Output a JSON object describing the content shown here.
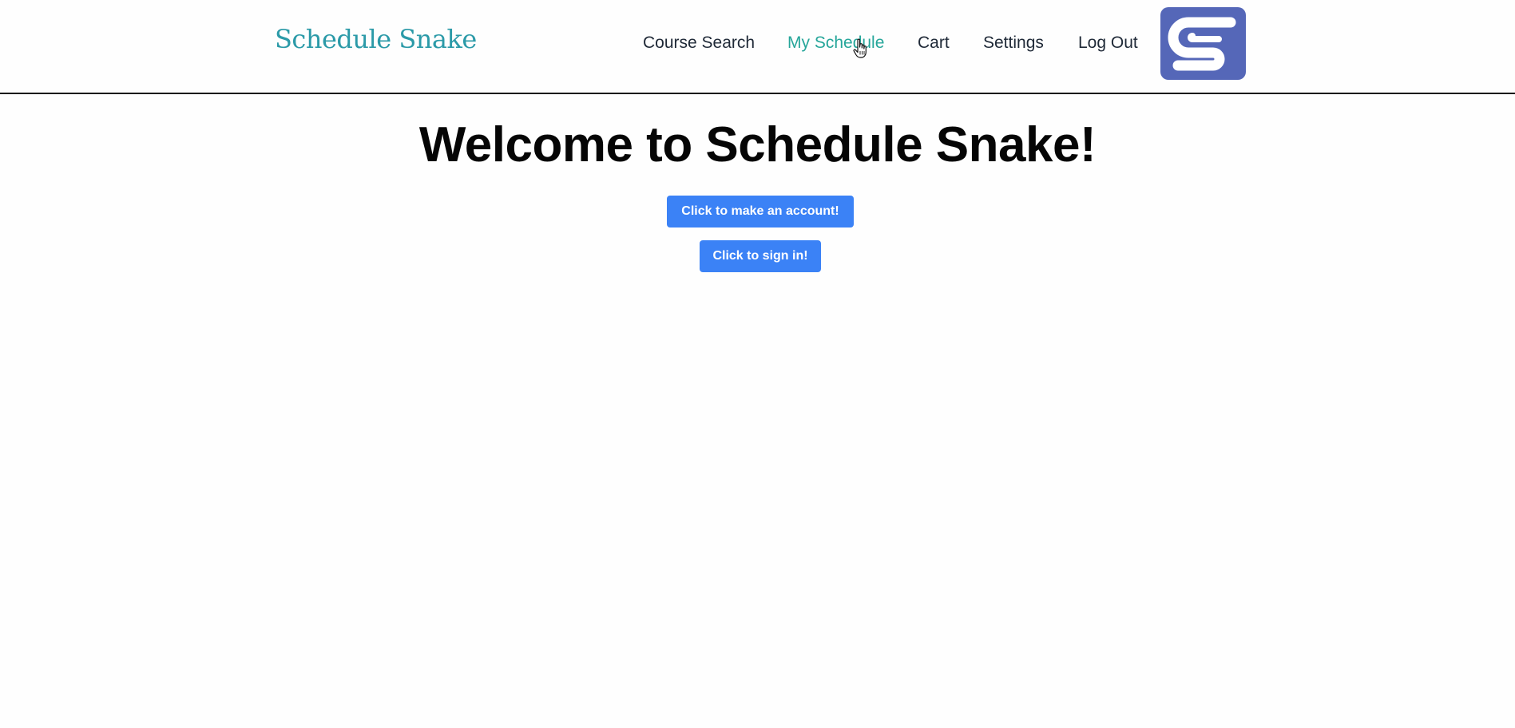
{
  "header": {
    "brand": "Schedule Snake",
    "nav": {
      "course_search": "Course Search",
      "my_schedule": "My Schedule",
      "cart": "Cart",
      "settings": "Settings",
      "log_out": "Log Out"
    },
    "active_item": "My Schedule",
    "logo_icon": "snake-s-logo-icon"
  },
  "main": {
    "welcome_heading": "Welcome to Schedule Snake!",
    "make_account_button": "Click to make an account!",
    "sign_in_button": "Click to sign in!"
  },
  "colors": {
    "brand_teal": "#2b9aa8",
    "active_link": "#26a69a",
    "nav_text": "#1f2937",
    "button_blue": "#3b82f6",
    "logo_bg": "#5567b8"
  }
}
